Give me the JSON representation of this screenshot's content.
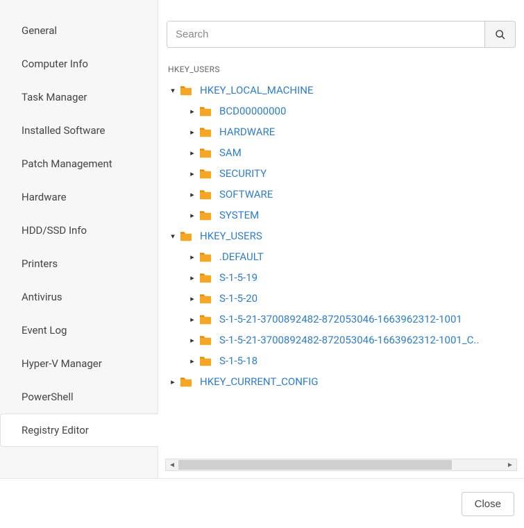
{
  "sidebar": {
    "items": [
      {
        "label": "General",
        "active": false
      },
      {
        "label": "Computer Info",
        "active": false
      },
      {
        "label": "Task Manager",
        "active": false
      },
      {
        "label": "Installed Software",
        "active": false
      },
      {
        "label": "Patch Management",
        "active": false
      },
      {
        "label": "Hardware",
        "active": false
      },
      {
        "label": "HDD/SSD Info",
        "active": false
      },
      {
        "label": "Printers",
        "active": false
      },
      {
        "label": "Antivirus",
        "active": false
      },
      {
        "label": "Event Log",
        "active": false
      },
      {
        "label": "Hyper-V Manager",
        "active": false
      },
      {
        "label": "PowerShell",
        "active": false
      },
      {
        "label": "Registry Editor",
        "active": true
      }
    ]
  },
  "search": {
    "placeholder": "Search",
    "value": ""
  },
  "breadcrumb": "HKEY_USERS",
  "tree": [
    {
      "label": "HKEY_LOCAL_MACHINE",
      "expanded": true,
      "children": [
        {
          "label": "BCD00000000",
          "expanded": false
        },
        {
          "label": "HARDWARE",
          "expanded": false
        },
        {
          "label": "SAM",
          "expanded": false
        },
        {
          "label": "SECURITY",
          "expanded": false
        },
        {
          "label": "SOFTWARE",
          "expanded": false
        },
        {
          "label": "SYSTEM",
          "expanded": false
        }
      ]
    },
    {
      "label": "HKEY_USERS",
      "expanded": true,
      "children": [
        {
          "label": ".DEFAULT",
          "expanded": false
        },
        {
          "label": "S-1-5-19",
          "expanded": false
        },
        {
          "label": "S-1-5-20",
          "expanded": false
        },
        {
          "label": "S-1-5-21-3700892482-872053046-1663962312-1001",
          "expanded": false
        },
        {
          "label": "S-1-5-21-3700892482-872053046-1663962312-1001_C..",
          "expanded": false
        },
        {
          "label": "S-1-5-18",
          "expanded": false
        }
      ]
    },
    {
      "label": "HKEY_CURRENT_CONFIG",
      "expanded": false,
      "children": []
    }
  ],
  "footer": {
    "close_label": "Close"
  }
}
